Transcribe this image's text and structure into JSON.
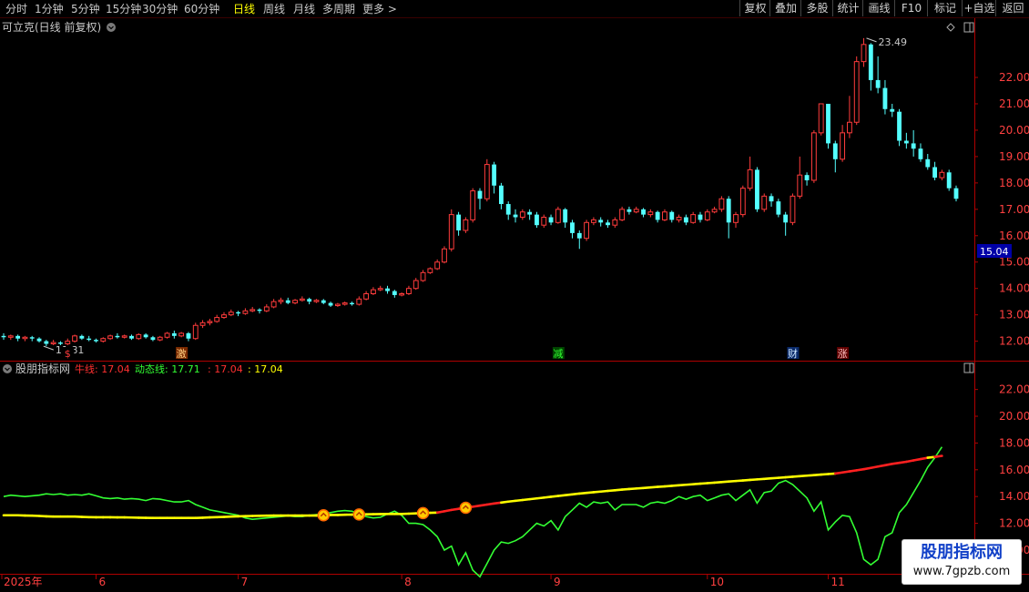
{
  "toolbar": {
    "periods": [
      "分时",
      "1分钟",
      "5分钟",
      "15分钟",
      "30分钟",
      "60分钟",
      "日线",
      "周线",
      "月线",
      "多周期",
      "更多 >"
    ],
    "active_period": "日线",
    "tools": [
      "复权",
      "叠加",
      "多股",
      "统计",
      "画线",
      "F10",
      "标记",
      "+自选",
      "返回"
    ]
  },
  "main_panel": {
    "title": "可立克(日线 前复权)",
    "high_label": "23.49",
    "low_label": "11.81",
    "price_badge": "15.04"
  },
  "sub_panel": {
    "title": "股朋指标网",
    "readout": [
      {
        "text": "牛线: 17.04",
        "color": "#ff3030"
      },
      {
        "text": "动态线: 17.71",
        "color": "#33ff33"
      },
      {
        "text": ": 17.04",
        "color": "#ff3030"
      },
      {
        "text": ": 17.04",
        "color": "#ffff00"
      }
    ]
  },
  "watermark": {
    "line1": "股朋指标网",
    "line2": "www.7gpzb.com"
  },
  "colors": {
    "up": "#ff3c3c",
    "down": "#54ffff",
    "bull_line": "#ffff00",
    "bull_red": "#ff2020",
    "dyn_line": "#33ff33",
    "grid": "#7a0000"
  },
  "chart_data": [
    {
      "type": "candlestick",
      "ylim": [
        11.4,
        23.9
      ],
      "y_ticks": [
        12.0,
        13.0,
        14.0,
        15.0,
        16.0,
        17.0,
        18.0,
        19.0,
        20.0,
        21.0,
        22.0
      ],
      "x_labels": [
        {
          "i": 0,
          "text": "2025年"
        },
        {
          "i": 13,
          "text": "6"
        },
        {
          "i": 33,
          "text": "7"
        },
        {
          "i": 56,
          "text": "8"
        },
        {
          "i": 77,
          "text": "9"
        },
        {
          "i": 99,
          "text": "10"
        },
        {
          "i": 116,
          "text": "11"
        }
      ],
      "markers": [
        {
          "i": 9,
          "text": "$",
          "color": "#ff3c3c",
          "bg": "#000"
        },
        {
          "i": 25,
          "text": "激",
          "color": "#ffd080",
          "bg": "#7a2a00"
        },
        {
          "i": 78,
          "text": "减",
          "color": "#33ff33",
          "bg": "#004400"
        },
        {
          "i": 111,
          "text": "财",
          "color": "#cfe8ff",
          "bg": "#0a2a6a"
        },
        {
          "i": 118,
          "text": "涨",
          "color": "#ffc0c0",
          "bg": "#600000"
        }
      ],
      "candles": [
        [
          12.2,
          12.15,
          12.3,
          12.05
        ],
        [
          12.15,
          12.2,
          12.25,
          12.05
        ],
        [
          12.2,
          12.1,
          12.25,
          12.0
        ],
        [
          12.1,
          12.15,
          12.2,
          12.0
        ],
        [
          12.15,
          12.1,
          12.2,
          12.0
        ],
        [
          12.1,
          12.0,
          12.15,
          11.95
        ],
        [
          12.0,
          11.9,
          12.05,
          11.81
        ],
        [
          11.9,
          11.95,
          12.05,
          11.85
        ],
        [
          11.95,
          11.9,
          12.0,
          11.85
        ],
        [
          11.9,
          12.0,
          12.1,
          11.85
        ],
        [
          12.0,
          12.2,
          12.25,
          11.95
        ],
        [
          12.2,
          12.1,
          12.25,
          12.05
        ],
        [
          12.1,
          12.05,
          12.2,
          12.0
        ],
        [
          12.05,
          12.0,
          12.1,
          11.95
        ],
        [
          12.0,
          12.1,
          12.15,
          11.95
        ],
        [
          12.1,
          12.2,
          12.25,
          12.05
        ],
        [
          12.2,
          12.15,
          12.3,
          12.1
        ],
        [
          12.15,
          12.2,
          12.25,
          12.1
        ],
        [
          12.2,
          12.1,
          12.25,
          12.05
        ],
        [
          12.1,
          12.25,
          12.3,
          12.05
        ],
        [
          12.25,
          12.15,
          12.3,
          12.1
        ],
        [
          12.15,
          12.05,
          12.2,
          12.0
        ],
        [
          12.05,
          12.15,
          12.2,
          12.0
        ],
        [
          12.15,
          12.3,
          12.35,
          12.1
        ],
        [
          12.3,
          12.2,
          12.4,
          12.1
        ],
        [
          12.2,
          12.3,
          12.35,
          12.15
        ],
        [
          12.3,
          12.1,
          12.35,
          12.0
        ],
        [
          12.1,
          12.6,
          12.7,
          12.05
        ],
        [
          12.6,
          12.7,
          12.8,
          12.5
        ],
        [
          12.7,
          12.75,
          12.85,
          12.6
        ],
        [
          12.75,
          12.9,
          13.0,
          12.7
        ],
        [
          12.9,
          13.0,
          13.1,
          12.85
        ],
        [
          13.0,
          13.1,
          13.2,
          12.95
        ],
        [
          13.1,
          13.05,
          13.15,
          12.95
        ],
        [
          13.05,
          13.15,
          13.25,
          13.0
        ],
        [
          13.15,
          13.2,
          13.3,
          13.1
        ],
        [
          13.2,
          13.15,
          13.25,
          13.05
        ],
        [
          13.15,
          13.3,
          13.4,
          13.1
        ],
        [
          13.3,
          13.5,
          13.6,
          13.25
        ],
        [
          13.5,
          13.55,
          13.65,
          13.4
        ],
        [
          13.55,
          13.45,
          13.65,
          13.4
        ],
        [
          13.45,
          13.55,
          13.6,
          13.4
        ],
        [
          13.55,
          13.6,
          13.7,
          13.5
        ],
        [
          13.6,
          13.5,
          13.65,
          13.4
        ],
        [
          13.5,
          13.55,
          13.6,
          13.45
        ],
        [
          13.55,
          13.45,
          13.6,
          13.4
        ],
        [
          13.45,
          13.35,
          13.5,
          13.3
        ],
        [
          13.35,
          13.4,
          13.45,
          13.3
        ],
        [
          13.4,
          13.45,
          13.5,
          13.35
        ],
        [
          13.45,
          13.4,
          13.5,
          13.35
        ],
        [
          13.4,
          13.6,
          13.7,
          13.35
        ],
        [
          13.6,
          13.8,
          13.9,
          13.55
        ],
        [
          13.8,
          13.95,
          14.05,
          13.75
        ],
        [
          13.95,
          14.0,
          14.1,
          13.9
        ],
        [
          14.0,
          13.9,
          14.1,
          13.8
        ],
        [
          13.9,
          13.75,
          13.95,
          13.65
        ],
        [
          13.75,
          13.8,
          13.85,
          13.7
        ],
        [
          13.8,
          14.0,
          14.1,
          13.75
        ],
        [
          14.0,
          14.3,
          14.4,
          13.95
        ],
        [
          14.3,
          14.6,
          14.7,
          14.25
        ],
        [
          14.6,
          14.75,
          14.8,
          14.55
        ],
        [
          14.75,
          15.0,
          15.1,
          14.7
        ],
        [
          15.0,
          15.5,
          15.6,
          14.95
        ],
        [
          15.5,
          16.8,
          17.0,
          15.4
        ],
        [
          16.8,
          16.2,
          16.9,
          16.0
        ],
        [
          16.2,
          16.6,
          16.7,
          16.1
        ],
        [
          16.6,
          17.7,
          17.8,
          16.5
        ],
        [
          17.7,
          17.4,
          17.8,
          17.0
        ],
        [
          17.4,
          18.7,
          18.9,
          17.3
        ],
        [
          18.7,
          17.9,
          18.8,
          17.6
        ],
        [
          17.9,
          17.2,
          18.0,
          17.0
        ],
        [
          17.2,
          16.8,
          17.3,
          16.6
        ],
        [
          16.8,
          16.7,
          17.0,
          16.5
        ],
        [
          16.7,
          16.9,
          17.0,
          16.6
        ],
        [
          16.9,
          16.8,
          17.0,
          16.6
        ],
        [
          16.8,
          16.4,
          16.9,
          16.3
        ],
        [
          16.4,
          16.7,
          16.8,
          16.3
        ],
        [
          16.7,
          16.5,
          16.8,
          16.4
        ],
        [
          16.5,
          17.0,
          17.1,
          16.45
        ],
        [
          17.0,
          16.5,
          17.05,
          16.3
        ],
        [
          16.5,
          16.1,
          16.6,
          15.9
        ],
        [
          16.1,
          15.9,
          16.2,
          15.5
        ],
        [
          15.9,
          16.5,
          16.6,
          15.8
        ],
        [
          16.5,
          16.6,
          16.7,
          16.4
        ],
        [
          16.6,
          16.5,
          16.7,
          16.35
        ],
        [
          16.5,
          16.4,
          16.6,
          16.3
        ],
        [
          16.4,
          16.6,
          16.7,
          16.3
        ],
        [
          16.6,
          17.0,
          17.1,
          16.55
        ],
        [
          17.0,
          16.9,
          17.1,
          16.8
        ],
        [
          16.9,
          17.0,
          17.1,
          16.85
        ],
        [
          17.0,
          16.8,
          17.05,
          16.7
        ],
        [
          16.8,
          16.9,
          17.0,
          16.7
        ],
        [
          16.9,
          16.6,
          16.95,
          16.5
        ],
        [
          16.6,
          16.9,
          17.0,
          16.55
        ],
        [
          16.9,
          16.6,
          16.95,
          16.5
        ],
        [
          16.6,
          16.7,
          16.8,
          16.5
        ],
        [
          16.7,
          16.5,
          16.8,
          16.4
        ],
        [
          16.5,
          16.8,
          16.9,
          16.45
        ],
        [
          16.8,
          16.6,
          16.9,
          16.5
        ],
        [
          16.6,
          16.9,
          17.0,
          16.55
        ],
        [
          16.9,
          17.0,
          17.1,
          16.85
        ],
        [
          17.0,
          17.4,
          17.5,
          16.9
        ],
        [
          17.4,
          16.5,
          17.5,
          15.9
        ],
        [
          16.5,
          16.8,
          16.9,
          16.3
        ],
        [
          16.8,
          17.8,
          17.9,
          16.7
        ],
        [
          17.8,
          18.5,
          19.0,
          17.7
        ],
        [
          18.5,
          17.0,
          18.6,
          16.9
        ],
        [
          17.0,
          17.5,
          17.6,
          16.9
        ],
        [
          17.5,
          17.3,
          17.6,
          17.1
        ],
        [
          17.3,
          16.8,
          17.4,
          16.7
        ],
        [
          16.8,
          16.5,
          16.9,
          16.0
        ],
        [
          16.5,
          17.5,
          17.6,
          16.4
        ],
        [
          17.5,
          18.3,
          19.0,
          17.4
        ],
        [
          18.3,
          18.1,
          18.4,
          17.9
        ],
        [
          18.1,
          19.9,
          20.0,
          18.0
        ],
        [
          19.9,
          21.0,
          21.0,
          19.8
        ],
        [
          21.0,
          19.5,
          21.0,
          19.3
        ],
        [
          19.5,
          18.9,
          19.6,
          18.4
        ],
        [
          18.9,
          19.9,
          20.2,
          18.8
        ],
        [
          19.9,
          20.3,
          21.3,
          19.7
        ],
        [
          20.3,
          22.6,
          22.8,
          20.2
        ],
        [
          22.6,
          23.25,
          23.49,
          22.4
        ],
        [
          23.25,
          21.9,
          23.3,
          21.5
        ],
        [
          21.9,
          21.6,
          22.8,
          21.4
        ],
        [
          21.6,
          20.8,
          21.9,
          20.6
        ],
        [
          20.8,
          20.7,
          21.0,
          20.5
        ],
        [
          20.7,
          19.6,
          20.8,
          19.4
        ],
        [
          19.6,
          19.5,
          19.9,
          19.3
        ],
        [
          19.5,
          19.3,
          20.0,
          19.0
        ],
        [
          19.3,
          18.9,
          19.5,
          18.8
        ],
        [
          18.9,
          18.6,
          19.1,
          18.5
        ],
        [
          18.6,
          18.2,
          18.8,
          18.1
        ],
        [
          18.2,
          18.4,
          18.5,
          18.1
        ],
        [
          18.4,
          17.8,
          18.5,
          17.7
        ],
        [
          17.8,
          17.4,
          17.9,
          17.3
        ]
      ]
    },
    {
      "type": "line",
      "ylim": [
        8.5,
        23.2
      ],
      "y_ticks": [
        10.0,
        12.0,
        14.0,
        16.0,
        18.0,
        20.0,
        22.0
      ],
      "series": [
        {
          "name": "牛线",
          "color": "#ffff00",
          "values": [
            12.6,
            12.6,
            12.6,
            12.58,
            12.57,
            12.55,
            12.52,
            12.5,
            12.5,
            12.5,
            12.5,
            12.48,
            12.46,
            12.45,
            12.45,
            12.45,
            12.44,
            12.44,
            12.43,
            12.42,
            12.41,
            12.4,
            12.4,
            12.4,
            12.4,
            12.4,
            12.4,
            12.4,
            12.42,
            12.44,
            12.46,
            12.48,
            12.5,
            12.52,
            12.54,
            12.55,
            12.56,
            12.57,
            12.58,
            12.58,
            12.58,
            12.58,
            12.58,
            12.58,
            12.58,
            12.6,
            12.62,
            12.62,
            12.64,
            12.65,
            12.66,
            12.67,
            12.68,
            12.69,
            12.7,
            12.7,
            12.7,
            12.72,
            12.74,
            12.76,
            12.78,
            12.8,
            12.9,
            13.0,
            13.08,
            13.16,
            13.24,
            13.32,
            13.4,
            13.48,
            13.55,
            13.62,
            13.68,
            13.74,
            13.8,
            13.86,
            13.92,
            13.98,
            14.04,
            14.1,
            14.16,
            14.22,
            14.27,
            14.32,
            14.37,
            14.42,
            14.47,
            14.52,
            14.56,
            14.6,
            14.64,
            14.68,
            14.72,
            14.76,
            14.8,
            14.84,
            14.88,
            14.92,
            14.96,
            15.0,
            15.04,
            15.08,
            15.12,
            15.16,
            15.2,
            15.24,
            15.28,
            15.32,
            15.36,
            15.4,
            15.44,
            15.48,
            15.52,
            15.56,
            15.6,
            15.64,
            15.68,
            15.72,
            15.8,
            15.88,
            15.96,
            16.04,
            16.14,
            16.24,
            16.34,
            16.44,
            16.52,
            16.6,
            16.7,
            16.8,
            16.9,
            16.96,
            17.04
          ]
        },
        {
          "name": "动态线",
          "color": "#33ff33",
          "values": [
            14.0,
            14.1,
            14.05,
            14.0,
            14.05,
            14.1,
            14.2,
            14.15,
            14.2,
            14.1,
            14.15,
            14.1,
            14.2,
            14.05,
            13.9,
            13.85,
            13.9,
            13.8,
            13.85,
            13.8,
            13.7,
            13.85,
            13.8,
            13.7,
            13.6,
            13.6,
            13.7,
            13.4,
            13.2,
            13.0,
            12.9,
            12.8,
            12.7,
            12.6,
            12.4,
            12.3,
            12.35,
            12.4,
            12.45,
            12.5,
            12.55,
            12.5,
            12.5,
            12.6,
            12.65,
            12.7,
            12.8,
            12.9,
            12.95,
            12.9,
            12.7,
            12.5,
            12.4,
            12.45,
            12.7,
            12.9,
            12.6,
            12.0,
            12.0,
            11.9,
            11.5,
            11.0,
            10.0,
            10.3,
            8.9,
            9.8,
            8.5,
            8.0,
            9.0,
            10.0,
            10.6,
            10.5,
            10.7,
            11.0,
            11.5,
            12.0,
            11.8,
            12.2,
            11.5,
            12.5,
            13.0,
            13.5,
            13.2,
            13.6,
            13.5,
            13.6,
            13.0,
            13.4,
            13.4,
            13.4,
            13.2,
            13.5,
            13.6,
            13.5,
            13.7,
            14.0,
            13.8,
            14.0,
            14.1,
            13.7,
            13.9,
            14.1,
            14.2,
            13.7,
            14.1,
            14.5,
            13.5,
            14.3,
            14.4,
            15.0,
            15.2,
            14.9,
            14.4,
            13.9,
            12.9,
            13.6,
            11.5,
            12.1,
            12.6,
            12.5,
            11.3,
            9.3,
            8.9,
            9.3,
            11.0,
            11.3,
            12.8,
            13.4,
            14.3,
            15.2,
            16.2,
            16.9,
            17.71
          ]
        }
      ],
      "signal_markers": [
        45,
        50,
        59,
        65
      ]
    }
  ]
}
